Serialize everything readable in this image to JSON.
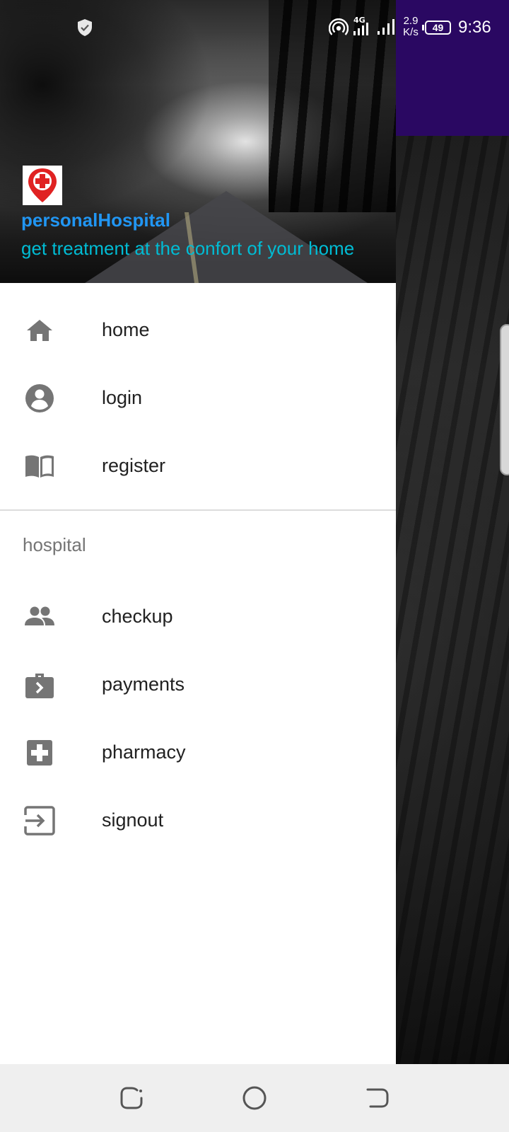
{
  "status_bar": {
    "network_speed": "2.9\nK/s",
    "network_speed_value": "2.9",
    "network_speed_unit": "K/s",
    "network_type": "4G",
    "battery": "49",
    "time": "9:36",
    "icons": [
      "shield-icon",
      "hotspot-icon",
      "4g-signal-icon",
      "signal-icon",
      "battery-icon"
    ]
  },
  "drawer": {
    "header": {
      "logo": "hospital-location-logo",
      "title": "personalHospital",
      "subtitle": "get treatment at the confort of your home",
      "title_color": "#2196f3",
      "subtitle_color": "#00bcd4"
    },
    "items": [
      {
        "label": "home",
        "icon": "home-icon"
      },
      {
        "label": "login",
        "icon": "account-circle-icon"
      },
      {
        "label": "register",
        "icon": "book-icon"
      }
    ],
    "section": {
      "title": "hospital",
      "items": [
        {
          "label": "checkup",
          "icon": "people-icon"
        },
        {
          "label": "payments",
          "icon": "briefcase-arrow-icon"
        },
        {
          "label": "pharmacy",
          "icon": "medical-plus-icon"
        },
        {
          "label": "signout",
          "icon": "exit-to-app-icon"
        }
      ]
    }
  },
  "app_bar": {
    "color": "#2a0862"
  },
  "nav_bar": {
    "buttons": [
      "recent-apps-icon",
      "home-circle-icon",
      "back-icon"
    ]
  }
}
